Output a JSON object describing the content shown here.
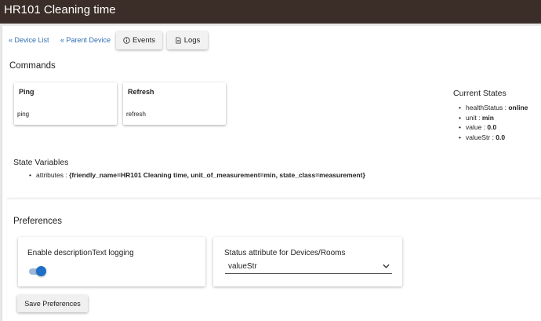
{
  "window": {
    "title": "HR101 Cleaning time"
  },
  "nav": {
    "device_list": "« Device List",
    "parent_device": "« Parent Device",
    "events_label": "Events",
    "logs_label": "Logs"
  },
  "commands": {
    "title": "Commands",
    "items": [
      {
        "title": "Ping",
        "name": "ping"
      },
      {
        "title": "Refresh",
        "name": "refresh"
      }
    ]
  },
  "current_states": {
    "title": "Current States",
    "items": [
      {
        "key": "healthStatus",
        "sep": " : ",
        "value": "online"
      },
      {
        "key": "unit",
        "sep": " : ",
        "value": "min"
      },
      {
        "key": "value",
        "sep": " : ",
        "value": "0.0"
      },
      {
        "key": "valueStr",
        "sep": " : ",
        "value": "0.0"
      }
    ]
  },
  "state_variables": {
    "title": "State Variables",
    "items": [
      {
        "key": "attributes",
        "sep": " : ",
        "value": "{friendly_name=HR101 Cleaning time, unit_of_measurement=min, state_class=measurement}"
      }
    ]
  },
  "preferences": {
    "title": "Preferences",
    "logging": {
      "label": "Enable descriptionText logging",
      "enabled": true
    },
    "status_attribute": {
      "label": "Status attribute for Devices/Rooms",
      "selected": "valueStr"
    },
    "save_label": "Save Preferences"
  },
  "colors": {
    "titlebar": "#3b2d27",
    "link": "#2f6fb3",
    "toggle_on": "#1e6fc7"
  }
}
